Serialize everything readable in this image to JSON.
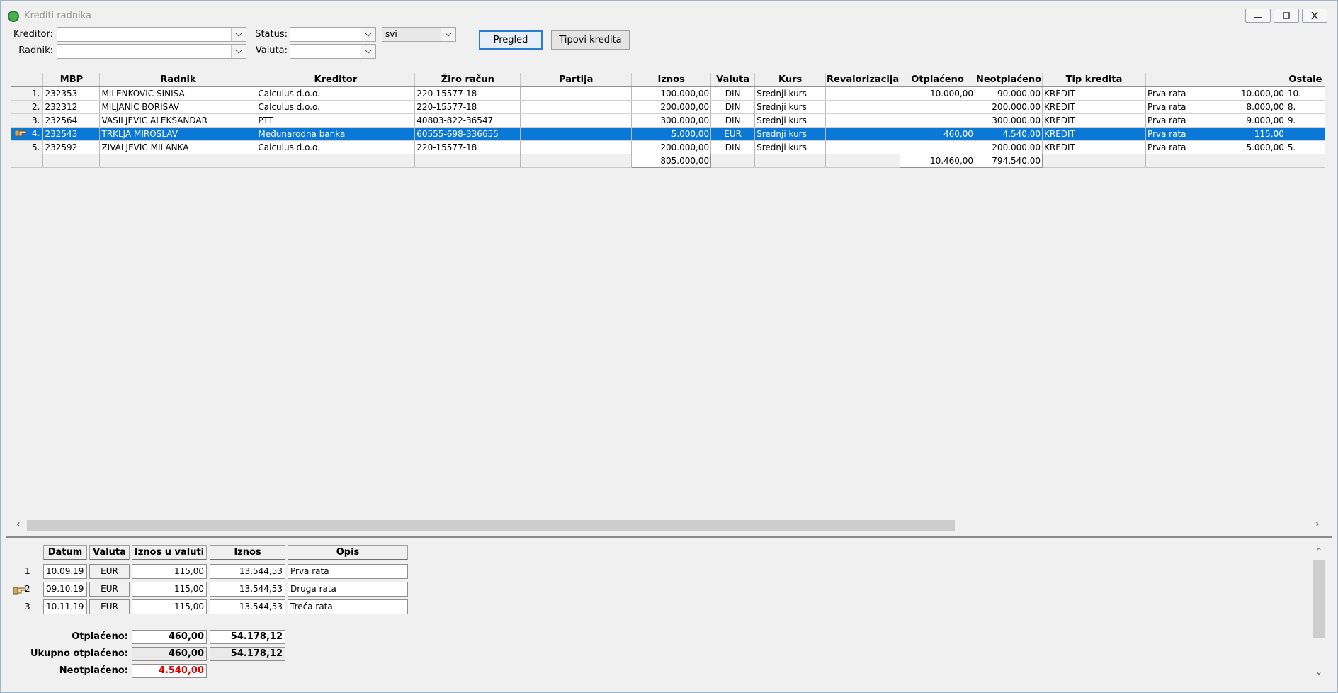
{
  "window": {
    "title": "Krediti radnika",
    "minimize_label": "minimize",
    "maximize_label": "maximize",
    "close_label": "close"
  },
  "filters": {
    "kreditor_label": "Kreditor:",
    "kreditor_value": "",
    "radnik_label": "Radnik:",
    "radnik_value": "",
    "status_label": "Status:",
    "status_value": "",
    "status2_value": "svi",
    "valuta_label": "Valuta:",
    "valuta_value": ""
  },
  "buttons": {
    "pregled": "Pregled",
    "tipovi": "Tipovi kredita"
  },
  "grid": {
    "headers": [
      "MBP",
      "Radnik",
      "Kreditor",
      "Žiro račun",
      "Partija",
      "Iznos",
      "Valuta",
      "Kurs",
      "Revalorizacija",
      "Otplaćeno",
      "Neotplaćeno",
      "Tip kredita",
      "",
      "",
      "Ostale"
    ],
    "rows": [
      {
        "num": "1.",
        "mbp": "232353",
        "radnik": "MILENKOVIC SINISA",
        "kreditor": "Calculus d.o.o.",
        "ziro": " 220-15577-18",
        "partija": "",
        "iznos": "100.000,00",
        "valuta": "DIN",
        "kurs": "Srednji kurs",
        "reval": "",
        "otplaceno": "10.000,00",
        "neotplaceno": "90.000,00",
        "tip": "KREDIT",
        "opis": "Prva rata",
        "rata": "10.000,00",
        "ostale": "10."
      },
      {
        "num": "2.",
        "mbp": "232312",
        "radnik": "MILJANIC BORISAV",
        "kreditor": "Calculus d.o.o.",
        "ziro": " 220-15577-18",
        "partija": "",
        "iznos": "200.000,00",
        "valuta": "DIN",
        "kurs": "Srednji kurs",
        "reval": "",
        "otplaceno": "",
        "neotplaceno": "200.000,00",
        "tip": "KREDIT",
        "opis": "Prva rata",
        "rata": "8.000,00",
        "ostale": "8."
      },
      {
        "num": "3.",
        "mbp": "232564",
        "radnik": "VASILJEVIC ALEKSANDAR",
        "kreditor": "PTT",
        "ziro": "40803-822-36547",
        "partija": "",
        "iznos": "300.000,00",
        "valuta": "DIN",
        "kurs": "Srednji kurs",
        "reval": "",
        "otplaceno": "",
        "neotplaceno": "300.000,00",
        "tip": "KREDIT",
        "opis": "Prva rata",
        "rata": "9.000,00",
        "ostale": "9."
      },
      {
        "num": "4.",
        "mbp": "232543",
        "radnik": "TRKLJA MIROSLAV",
        "kreditor": "Međunarodna banka",
        "ziro": "60555-698-336655",
        "partija": "",
        "iznos": "5.000,00",
        "valuta": "EUR",
        "kurs": "Srednji kurs",
        "reval": "",
        "otplaceno": "460,00",
        "neotplaceno": "4.540,00",
        "tip": "KREDIT",
        "opis": "Prva rata",
        "rata": "115,00",
        "ostale": ""
      },
      {
        "num": "5.",
        "mbp": "232592",
        "radnik": "ZIVALJEVIC MILANKA",
        "kreditor": "Calculus d.o.o.",
        "ziro": " 220-15577-18",
        "partija": "",
        "iznos": "200.000,00",
        "valuta": "DIN",
        "kurs": "Srednji kurs",
        "reval": "",
        "otplaceno": "",
        "neotplaceno": "200.000,00",
        "tip": "KREDIT",
        "opis": "Prva rata",
        "rata": "5.000,00",
        "ostale": "5."
      }
    ],
    "totals": {
      "iznos": "805.000,00",
      "otplaceno": "10.460,00",
      "neotplaceno": "794.540,00"
    },
    "selected_row": 3
  },
  "detail": {
    "headers": {
      "datum": "Datum",
      "valuta": "Valuta",
      "iznos_valuta": "Iznos u valuti",
      "iznos": "Iznos",
      "opis": "Opis"
    },
    "rows": [
      {
        "num": "1",
        "datum": "10.09.19",
        "valuta": "EUR",
        "iznos_valuta": "115,00",
        "iznos": "13.544,53",
        "opis": "Prva rata"
      },
      {
        "num": "2",
        "datum": "09.10.19",
        "valuta": "EUR",
        "iznos_valuta": "115,00",
        "iznos": "13.544,53",
        "opis": "Druga rata"
      },
      {
        "num": "3",
        "datum": "10.11.19",
        "valuta": "EUR",
        "iznos_valuta": "115,00",
        "iznos": "13.544,53",
        "opis": "Treća rata"
      }
    ],
    "summary": {
      "otplaceno_label": "Otplaćeno:",
      "otplaceno_valuta": "460,00",
      "otplaceno_iznos": "54.178,12",
      "ukupno_label": "Ukupno otplaćeno:",
      "ukupno_valuta": "460,00",
      "ukupno_iznos": "54.178,12",
      "neotplaceno_label": "Neotplaćeno:",
      "neotplaceno_valuta": "4.540,00"
    }
  },
  "colors": {
    "selection": "#0a78d7",
    "accent": "#2a7bd4",
    "negative": "#e00000"
  }
}
